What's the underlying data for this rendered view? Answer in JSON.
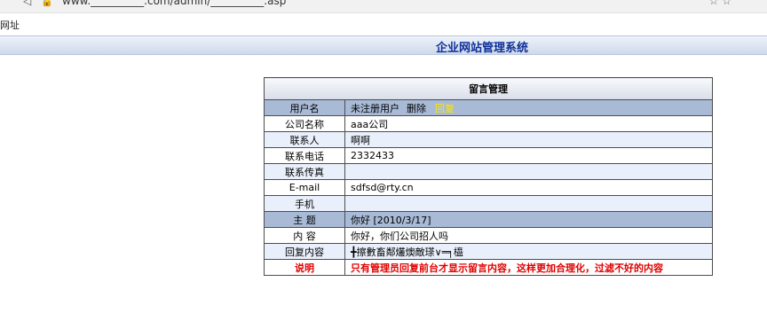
{
  "browser": {
    "url": "www.__________.com/admin/__________.asp",
    "nav_icons": "◁",
    "lock": "🔓",
    "right_icons": "☆ ☆"
  },
  "favbar": {
    "label": "网址"
  },
  "header": {
    "title": "企业网站管理系统"
  },
  "panel": {
    "caption": "留言管理",
    "rows": [
      {
        "label": "用户名",
        "value": "未注册用户",
        "delete": "删除",
        "reply": "回复"
      },
      {
        "label": "公司名称",
        "value": "aaa公司"
      },
      {
        "label": "联系人",
        "value": "啊啊"
      },
      {
        "label": "联系电话",
        "value": "2332433"
      },
      {
        "label": "联系传真",
        "value": ""
      },
      {
        "label": "E-mail",
        "value": "sdfsd@rty.cn"
      },
      {
        "label": "手机",
        "value": ""
      },
      {
        "label": "主 题",
        "value": "你好 [2010/3/17]"
      },
      {
        "label": "内 容",
        "value": "你好，你们公司招人吗"
      },
      {
        "label": "回复内容",
        "value": "╋擦數畜鄰爜燠敵瑹∨═╕橀"
      },
      {
        "label": "说明",
        "value": "只有管理员回复前台才显示留言内容，这样更加合理化，过滤不好的内容"
      }
    ]
  }
}
